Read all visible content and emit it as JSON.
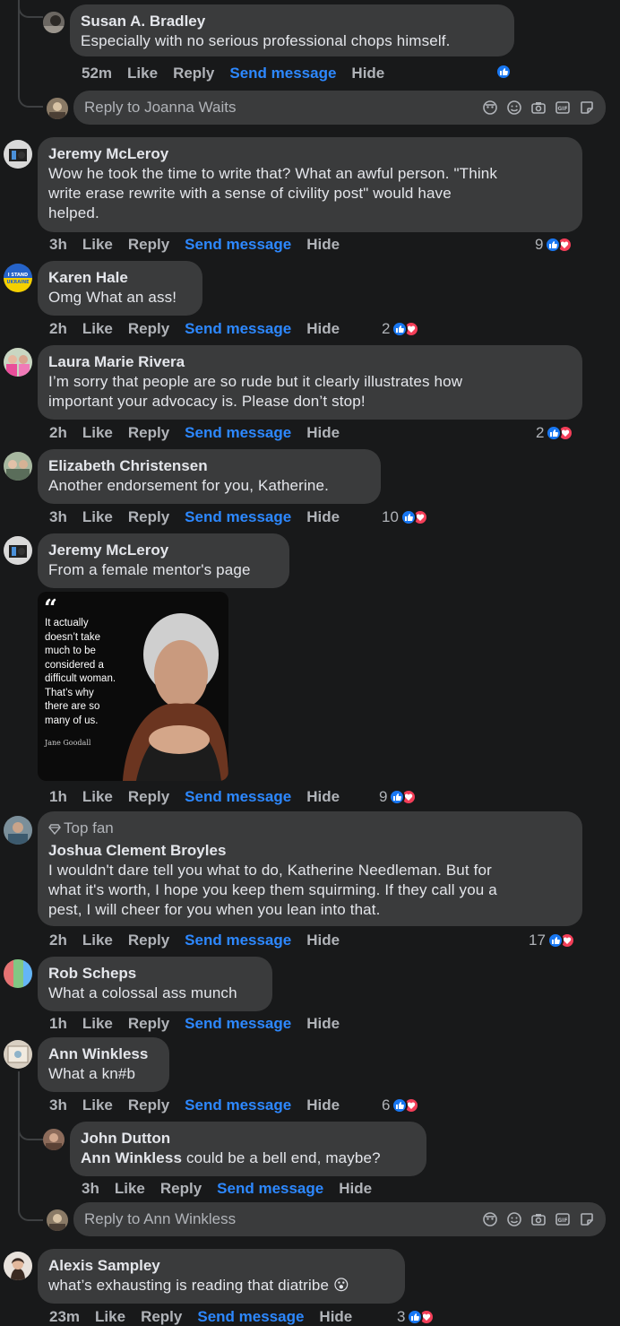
{
  "ui": {
    "like": "Like",
    "reply": "Reply",
    "send": "Send message",
    "hide": "Hide"
  },
  "colors": {
    "background": "#18191a",
    "bubble": "#3a3b3c",
    "link": "#2d88ff",
    "muted": "#b0b3b8",
    "like": "#1877f2",
    "love": "#f33e58"
  },
  "comments": [
    {
      "author": "Susan A. Bradley",
      "text": [
        "Especially with no serious professional chops himself."
      ],
      "time": "52m",
      "reactions": "",
      "reaction_types": [
        "like"
      ]
    },
    {
      "author": "Jeremy McLeroy",
      "text": [
        "Wow he took the time to write that? What an awful person. \"Think",
        "write erase rewrite with a sense of civility post\" would have",
        "helped."
      ],
      "time": "3h",
      "reactions": "9",
      "reaction_types": [
        "like",
        "love"
      ]
    },
    {
      "author": "Karen Hale",
      "text": [
        "Omg What an ass!"
      ],
      "time": "2h",
      "reactions": "2",
      "reaction_types": [
        "like",
        "love"
      ]
    },
    {
      "author": "Laura Marie Rivera",
      "text": [
        "I’m sorry that people are so rude but it clearly illustrates how",
        "important your advocacy is. Please don’t stop!"
      ],
      "time": "2h",
      "reactions": "2",
      "reaction_types": [
        "like",
        "love"
      ]
    },
    {
      "author": "Elizabeth Christensen",
      "text": [
        "Another endorsement for you, Katherine."
      ],
      "time": "3h",
      "reactions": "10",
      "reaction_types": [
        "like",
        "love"
      ]
    },
    {
      "author": "Jeremy McLeroy",
      "text": [
        "From a female mentor's page"
      ],
      "time": "1h",
      "reactions": "9",
      "reaction_types": [
        "like",
        "love"
      ],
      "image": {
        "quote": [
          "It actually",
          "doesn’t take",
          "much to be",
          "considered a",
          "difficult woman.",
          "That’s why",
          "there are so",
          "many of us."
        ],
        "author": "Jane Goodall"
      }
    },
    {
      "badge": "Top fan",
      "author": "Joshua Clement Broyles",
      "text": [
        "I wouldn't dare tell you what to do, Katherine Needleman. But for",
        "what it's worth, I hope you keep them squirming. If they call you a",
        "pest, I will cheer for you when you lean into that."
      ],
      "time": "2h",
      "reactions": "17",
      "reaction_types": [
        "like",
        "love"
      ]
    },
    {
      "author": "Rob Scheps",
      "text": [
        "What a colossal ass munch"
      ],
      "time": "1h",
      "reactions": "",
      "reaction_types": []
    },
    {
      "author": "Ann Winkless",
      "text": [
        "What a kn#b"
      ],
      "time": "3h",
      "reactions": "6",
      "reaction_types": [
        "like",
        "love"
      ]
    },
    {
      "author": "John Dutton",
      "tag": "Ann Winkless",
      "text": [
        "could be a bell end, maybe?"
      ],
      "time": "3h",
      "reactions": "",
      "reaction_types": []
    },
    {
      "author": "Alexis Sampley",
      "text": [
        "what’s exhausting is reading that diatribe 😮"
      ],
      "time": "23m",
      "reactions": "3",
      "reaction_types": [
        "like",
        "love"
      ]
    }
  ],
  "reply_boxes": [
    {
      "placeholder": "Reply to Joanna Waits"
    },
    {
      "placeholder": "Reply to Ann Winkless"
    }
  ]
}
